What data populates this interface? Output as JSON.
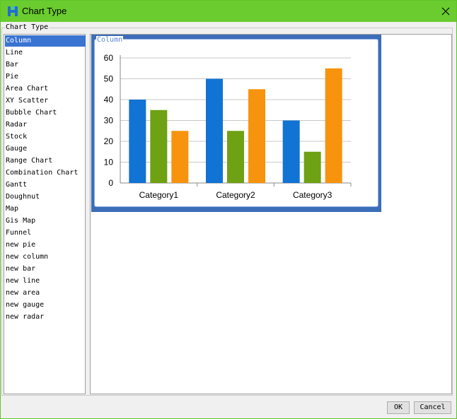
{
  "window": {
    "title": "Chart Type"
  },
  "group": {
    "label": "Chart Type"
  },
  "list": {
    "items": [
      "Column",
      "Line",
      "Bar",
      "Pie",
      "Area Chart",
      "XY Scatter",
      "Bubble Chart",
      "Radar",
      "Stock",
      "Gauge",
      "Range Chart",
      "Combination Chart",
      "Gantt",
      "Doughnut",
      "Map",
      "Gis Map",
      "Funnel",
      "new pie",
      "new column",
      "new bar",
      "new line",
      "new area",
      "new gauge",
      "new radar"
    ],
    "selected_index": 0
  },
  "preview": {
    "label": "Column"
  },
  "chart_data": {
    "type": "bar",
    "categories": [
      "Category1",
      "Category2",
      "Category3"
    ],
    "series": [
      {
        "values": [
          40,
          50,
          30
        ],
        "color": "#1173d4"
      },
      {
        "values": [
          35,
          25,
          15
        ],
        "color": "#6ea113"
      },
      {
        "values": [
          25,
          45,
          55
        ],
        "color": "#f7930d"
      }
    ],
    "ylim": [
      0,
      60
    ],
    "yticks": [
      0,
      10,
      20,
      30,
      40,
      50,
      60
    ],
    "grid": true,
    "title": "",
    "xlabel": "",
    "ylabel": ""
  },
  "buttons": {
    "ok": "OK",
    "cancel": "Cancel"
  }
}
